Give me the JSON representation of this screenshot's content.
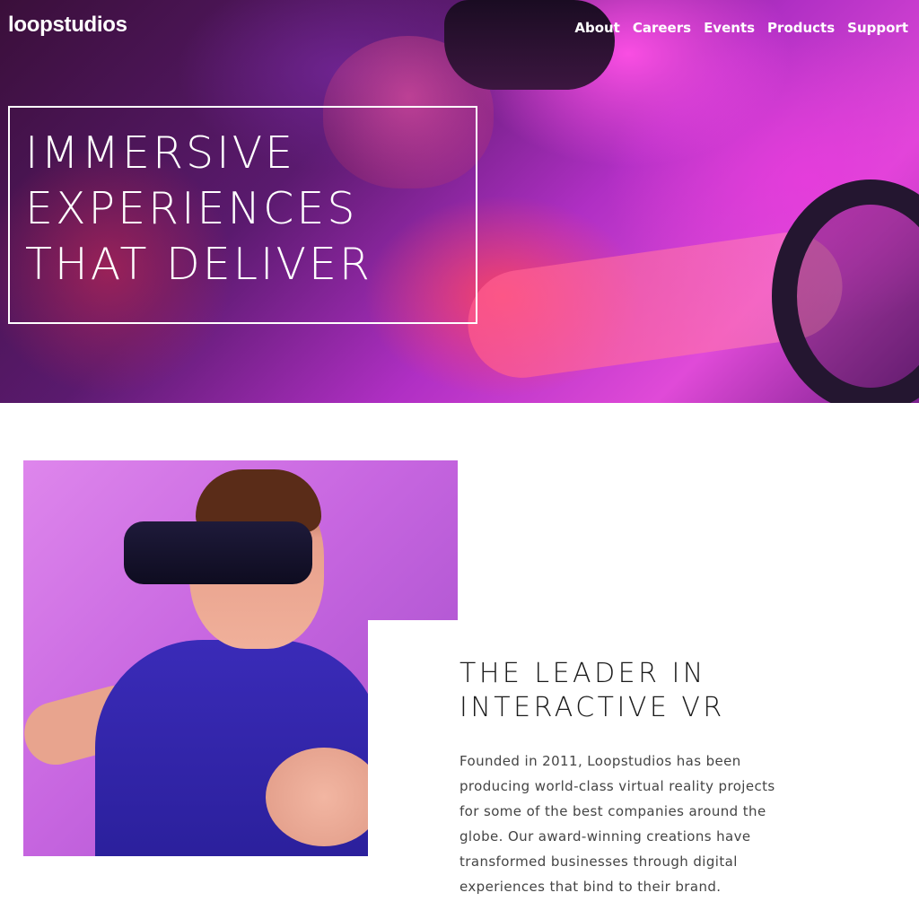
{
  "header": {
    "logo": "loopstudios",
    "nav": [
      "About",
      "Careers",
      "Events",
      "Products",
      "Support"
    ]
  },
  "hero": {
    "lines": [
      "IMMERSIVE",
      "EXPERIENCES",
      "THAT DELIVER"
    ]
  },
  "about": {
    "title_lines": [
      "THE LEADER IN",
      "INTERACTIVE VR"
    ],
    "text_lines": [
      "Founded in 2011, Loopstudios has been",
      "producing world-class virtual reality projects",
      "for some of the best companies around the",
      "globe. Our award-winning creations have",
      "transformed businesses through digital",
      "experiences that bind to their brand."
    ]
  },
  "colors": {
    "hero_accent": "#e04ad8",
    "about_image_bg": "#c766e0",
    "text_dark": "#1a1a1a",
    "text_body": "#444444"
  }
}
